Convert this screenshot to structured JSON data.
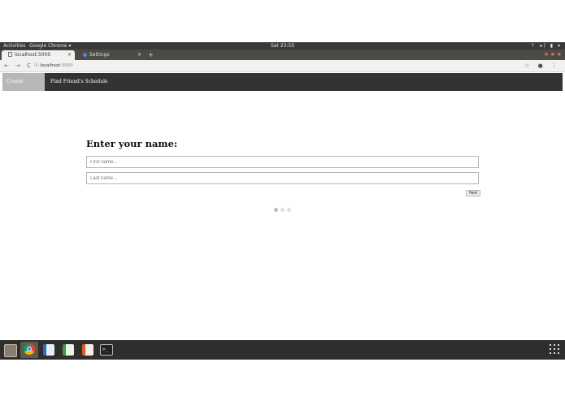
{
  "topbar": {
    "activities": "Activities",
    "app_name": "Google Chrome ▾",
    "clock": "Sat 23:55",
    "tray": "⇡ ◂) ▮ ▾"
  },
  "browser": {
    "tabs": [
      {
        "label": "localhost:5000",
        "close": "×"
      },
      {
        "label": "Settings",
        "close": "×"
      }
    ],
    "new_tab": "+",
    "window_controls": "● ● ●",
    "nav_buttons": "← → C",
    "url_host": "localhost",
    "url_port": ":5000",
    "right_icons": "☆ ● ⋮"
  },
  "appnav": {
    "items": [
      {
        "label": "Create Schedule"
      },
      {
        "label": "Find Friend's Schedule"
      }
    ]
  },
  "form": {
    "heading": "Enter your name:",
    "first_placeholder": "First name...",
    "last_placeholder": "Last name...",
    "next_label": "Next",
    "steps": 3,
    "current_step": 1
  },
  "taskbar": {
    "icons": [
      "files-icon",
      "chrome-icon",
      "writer-icon",
      "calc-icon",
      "impress-icon",
      "terminal-icon",
      "app-grid-icon"
    ],
    "terminal_glyph": ">_"
  }
}
